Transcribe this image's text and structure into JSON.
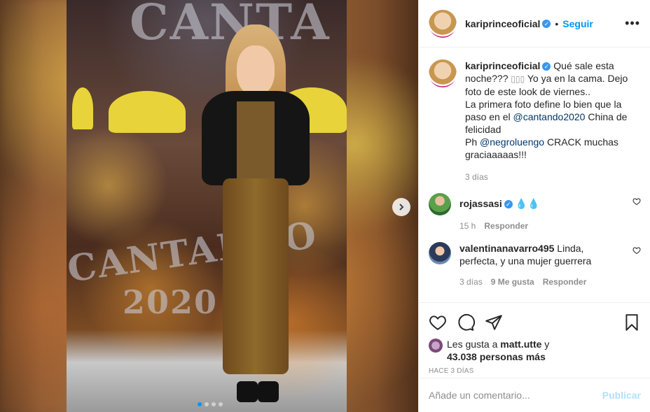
{
  "header": {
    "username": "kariprinceoficial",
    "follow_label": "Seguir",
    "more_icon": "more-icon"
  },
  "caption": {
    "username": "kariprinceoficial",
    "text_1": "Qué sale esta noche??? ",
    "emoji": "▯▯▯",
    "text_2": " Yo ya en la cama. Dejo foto de este look de viernes..",
    "line_2": "La primera foto define lo bien que la paso en el ",
    "mention_1": "@cantando2020",
    "text_3": " China de felicidad",
    "line_3_prefix": "Ph ",
    "mention_2": "@negroluengo",
    "text_4": " CRACK muchas graciaaaaas!!!",
    "time": "3 días"
  },
  "comments": [
    {
      "username": "rojassasi",
      "verified": true,
      "text": "💧💧",
      "time": "15 h",
      "reply_label": "Responder"
    },
    {
      "username": "valentinanavarro495",
      "text": "Linda, perfecta, y una mujer guerrera",
      "time": "3 días",
      "likes": "9 Me gusta",
      "reply_label": "Responder"
    }
  ],
  "likes": {
    "prefix": "Les gusta a ",
    "user": "matt.utte",
    "middle": " y ",
    "count": "43.038 personas más"
  },
  "post_time": "HACE 3 DÍAS",
  "add_comment": {
    "placeholder": "Añade un comentario...",
    "publish_label": "Publicar"
  },
  "photo": {
    "stage_text_top": "CANTA",
    "stage_text_mid": "CANTANDO",
    "stage_text_year": "2020"
  },
  "colors": {
    "accent": "#0095f6",
    "publish_disabled": "#b2dffc",
    "verified": "#3897f0"
  }
}
